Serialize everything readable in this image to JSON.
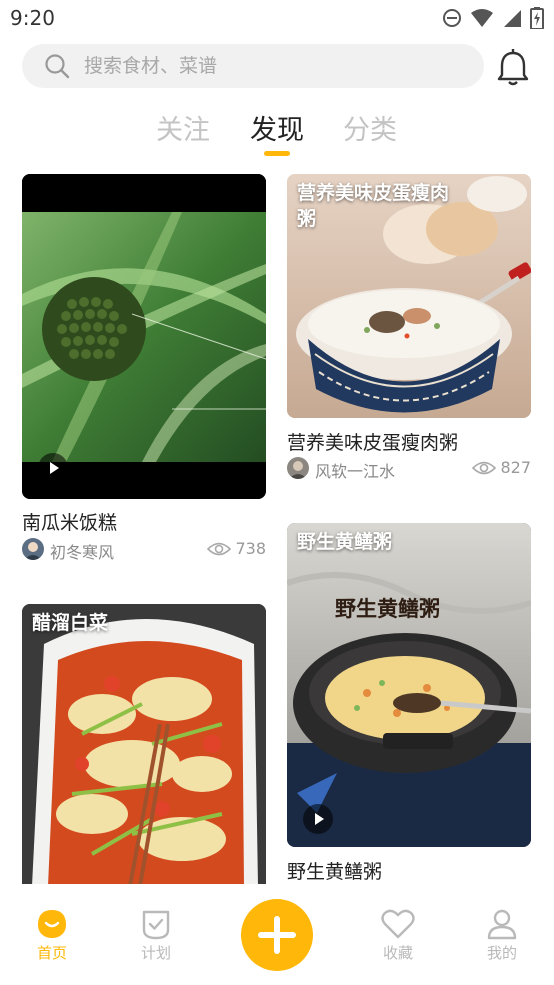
{
  "status_bar": {
    "time": "9:20"
  },
  "search": {
    "placeholder": "搜索食材、菜谱"
  },
  "tabs": [
    {
      "label": "关注",
      "active": false
    },
    {
      "label": "发现",
      "active": true
    },
    {
      "label": "分类",
      "active": false
    }
  ],
  "feed": {
    "left": [
      {
        "title": "南瓜米饭糕",
        "author": "初冬寒风",
        "views": "738",
        "video": true,
        "overlay": ""
      },
      {
        "title": "",
        "overlay": "醋溜白菜",
        "video": false
      }
    ],
    "right": [
      {
        "title": "营养美味皮蛋瘦肉粥",
        "overlay": "营养美味皮蛋瘦肉粥",
        "author": "风软一江水",
        "views": "827",
        "video": false
      },
      {
        "title": "野生黄鳝粥",
        "overlay": "野生黄鳝粥",
        "video": true
      }
    ]
  },
  "bottom_nav": [
    {
      "label": "首页",
      "icon": "home-icon",
      "active": true
    },
    {
      "label": "计划",
      "icon": "plan-icon",
      "active": false
    },
    {
      "label": "收藏",
      "icon": "heart-icon",
      "active": false
    },
    {
      "label": "我的",
      "icon": "profile-icon",
      "active": false
    }
  ],
  "colors": {
    "accent": "#ffb80a",
    "muted": "#b9b9b9"
  }
}
